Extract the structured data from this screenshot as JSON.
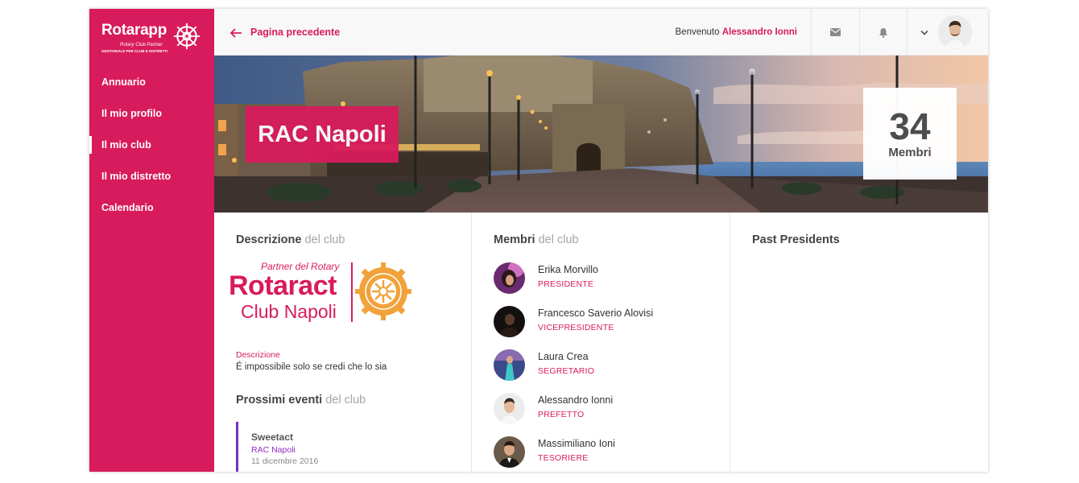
{
  "brand": {
    "name": "Rotarapp",
    "tagline": "Rotary Club Partner",
    "subtitle": "GESTIONALE PER CLUB E DISTRETTI"
  },
  "sidebar": {
    "items": [
      {
        "label": "Annuario"
      },
      {
        "label": "Il mio profilo"
      },
      {
        "label": "Il mio club"
      },
      {
        "label": "Il mio distretto"
      },
      {
        "label": "Calendario"
      }
    ],
    "active_index": 2
  },
  "topbar": {
    "back_label": "Pagina precedente",
    "welcome_text": "Benvenuto",
    "user_name": "Alessandro Ionni"
  },
  "hero": {
    "club_name": "RAC Napoli",
    "member_count": "34",
    "member_label": "Membri"
  },
  "description": {
    "title_bold": "Descrizione",
    "title_light": "del club",
    "logo_partner": "Partner del Rotary",
    "logo_name": "Rotaract",
    "logo_city": "Club Napoli",
    "label": "Descrizione",
    "text": "É impossibile solo se credi che lo sia"
  },
  "events": {
    "title_bold": "Prossimi eventi",
    "title_light": "del club",
    "items": [
      {
        "name": "Sweetact",
        "club": "RAC Napoli",
        "date": "11 dicembre 2016"
      }
    ]
  },
  "members": {
    "title_bold": "Membri",
    "title_light": "del club",
    "items": [
      {
        "name": "Erika Morvillo",
        "role": "PRESIDENTE"
      },
      {
        "name": "Francesco Saverio Alovisi",
        "role": "VICEPRESIDENTE"
      },
      {
        "name": "Laura Crea",
        "role": "SEGRETARIO"
      },
      {
        "name": "Alessandro Ionni",
        "role": "PREFETTO"
      },
      {
        "name": "Massimiliano Ioni",
        "role": "TESORIERE"
      }
    ]
  },
  "past_presidents": {
    "title": "Past Presidents"
  },
  "colors": {
    "accent": "#d81b5c",
    "event_accent": "#7b2ec0"
  },
  "icons": {
    "back": "arrow-left-icon",
    "mail": "mail-icon",
    "bell": "bell-icon",
    "dropdown": "chevron-down-icon"
  }
}
